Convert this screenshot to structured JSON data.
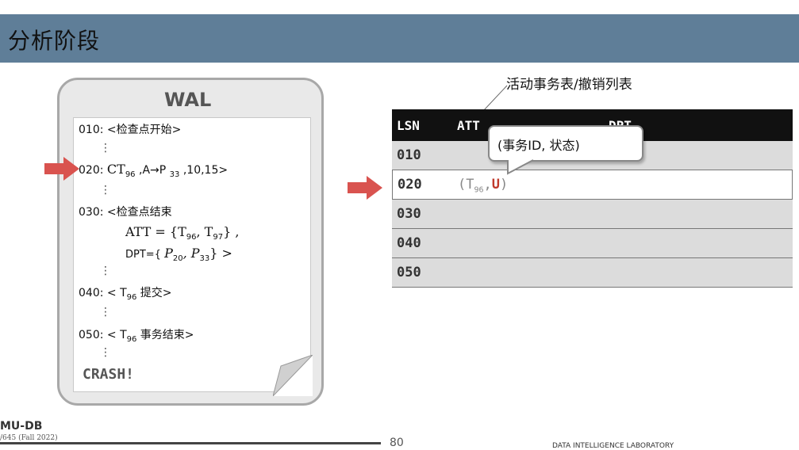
{
  "slide": {
    "title": "分析阶段"
  },
  "wal": {
    "title": "WAL",
    "line010": "010: <检查点开始>",
    "line020_prefix": "020: ",
    "line020_ct": "CT",
    "line020_sub": "96",
    "line020_rest": " ,A→P ",
    "line020_p": "33",
    "line020_end": " ,10,15>",
    "line030": "030: <检查点结束",
    "att_label": "ATT = {T",
    "att_sub1": "96",
    "att_mid": ", T",
    "att_sub2": "97",
    "att_end": "} ,",
    "dpt_label": "DPT={ ",
    "dpt_p1": "P",
    "dpt_sub1": "20",
    "dpt_mid": ", P",
    "dpt_sub2": "33",
    "dpt_end": "} >",
    "line040_prefix": "040: < T",
    "line040_sub": "96",
    "line040_end": " 提交>",
    "line050_prefix": "050: < T",
    "line050_sub": "96",
    "line050_end": " 事务结束>",
    "crash": "CRASH!",
    "vdots": "⋮"
  },
  "callout": {
    "label": "活动事务表/撤销列表",
    "bubble": "(事务ID, 状态)"
  },
  "table": {
    "headers": [
      "LSN",
      "ATT",
      "DPT"
    ],
    "rows": [
      {
        "lsn": "010",
        "att_open": "",
        "att_t": "",
        "att_sub": "",
        "att_status": "",
        "att_close": ""
      },
      {
        "lsn": "020",
        "att_open": "(T",
        "att_sub": "96",
        "att_comma": ",",
        "att_status": "U",
        "att_close": ")"
      },
      {
        "lsn": "030"
      },
      {
        "lsn": "040"
      },
      {
        "lsn": "050"
      }
    ]
  },
  "footer": {
    "logo": "MU-DB",
    "course": "/645 (Fall 2022)",
    "page": "80",
    "lab": "DATA INTELLIGENCE LABORATORY"
  },
  "colors": {
    "title_bar": "#5f7e98",
    "arrow": "#d9534f",
    "status_u": "#c0392b"
  }
}
